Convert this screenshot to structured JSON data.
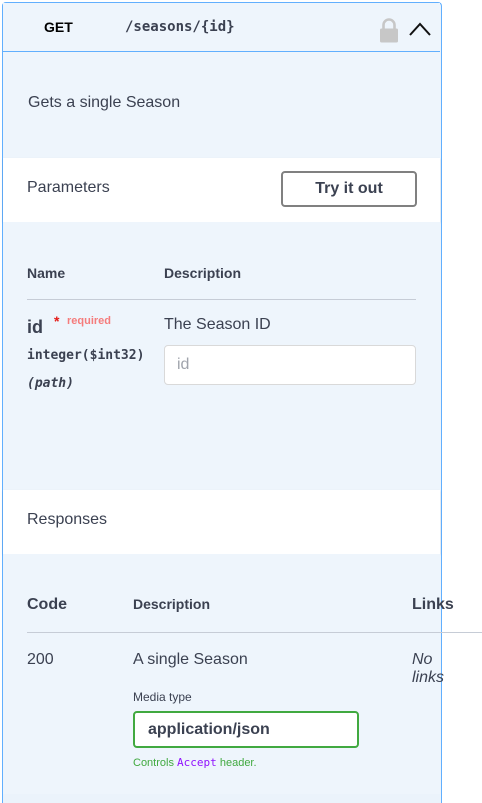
{
  "operation": {
    "method": "GET",
    "path": "/seasons/{id}",
    "summary": "Gets a single Season"
  },
  "parameters": {
    "section_title": "Parameters",
    "try_it_out_label": "Try it out",
    "columns": {
      "name": "Name",
      "description": "Description"
    },
    "items": [
      {
        "name": "id",
        "required_star": "*",
        "required_label": "required",
        "type": "integer($int32)",
        "in": "(path)",
        "description": "The Season ID",
        "placeholder": "id"
      }
    ]
  },
  "responses": {
    "section_title": "Responses",
    "columns": {
      "code": "Code",
      "description": "Description",
      "links": "Links"
    },
    "items": [
      {
        "code": "200",
        "description": "A single Season",
        "links": "No links",
        "media_type_label": "Media type",
        "media_type_value": "application/json",
        "controls_prefix": "Controls",
        "controls_code": "Accept",
        "controls_suffix": "header."
      }
    ]
  },
  "colors": {
    "get_accent": "#61affe",
    "required": "#f57c7c",
    "media_select_border": "#41a940",
    "code_accent": "#9012fe"
  },
  "icons": [
    "lock-icon",
    "chevron-up-icon"
  ]
}
